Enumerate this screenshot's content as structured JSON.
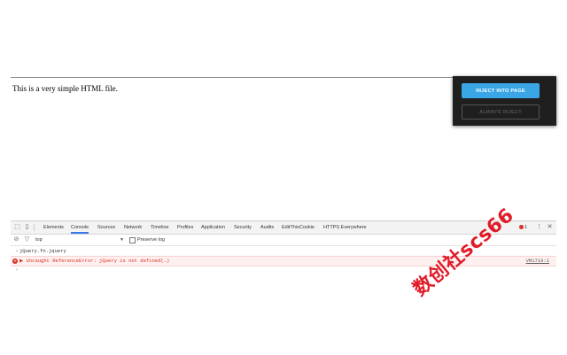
{
  "page": {
    "body_text": "This is a very simple HTML file."
  },
  "popup": {
    "inject_label": "INJECT INTO PAGE",
    "always_label": "ALWAYS INJECT"
  },
  "devtools": {
    "tabs": [
      "Elements",
      "Console",
      "Sources",
      "Network",
      "Timeline",
      "Profiles",
      "Application",
      "Security",
      "Audits",
      "EditThisCookie",
      "HTTPS Everywhere"
    ],
    "active_tab": "Console",
    "error_count": "1",
    "context": "top",
    "preserve_log_label": "Preserve log",
    "console": {
      "command": "jQuery.fn.jquery",
      "error_text": "Uncaught ReferenceError: jQuery is not defined(…)",
      "error_source": "VM1719:1"
    }
  },
  "watermark": "数创社scs66",
  "colors": {
    "accent": "#3aa6e6",
    "error": "#d93025",
    "watermark": "#e0101e"
  }
}
